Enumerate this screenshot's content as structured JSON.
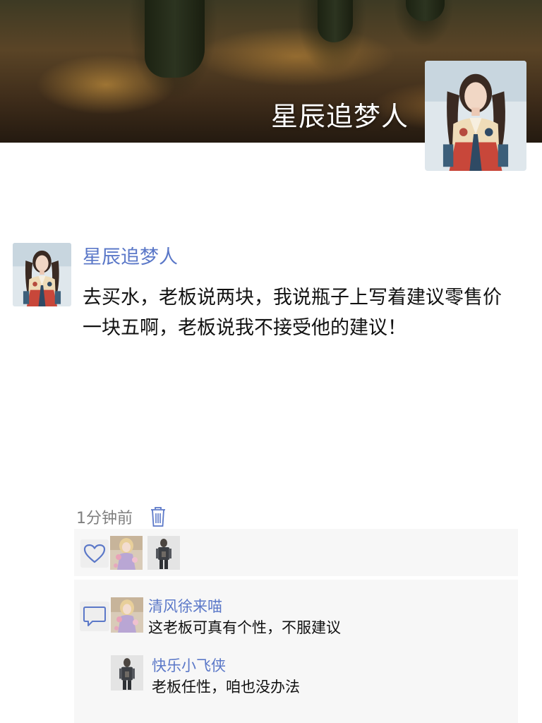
{
  "cover": {
    "username": "星辰追梦人"
  },
  "post": {
    "author": "星辰追梦人",
    "text": "去买水，老板说两块，我说瓶子上写着建议零售价一块五啊，老板说我不接受他的建议！",
    "time": "1分钟前"
  },
  "likes": {
    "heart_icon": "heart-icon"
  },
  "comments": [
    {
      "author": "清风徐来喵",
      "text": "这老板可真有个性，不服建议"
    },
    {
      "author": "快乐小飞侠",
      "text": "老板任性，咱也没办法"
    }
  ],
  "colors": {
    "name_blue": "#5b78c8",
    "panel_bg": "#f7f7f7",
    "time_gray": "#7f7f7f"
  }
}
